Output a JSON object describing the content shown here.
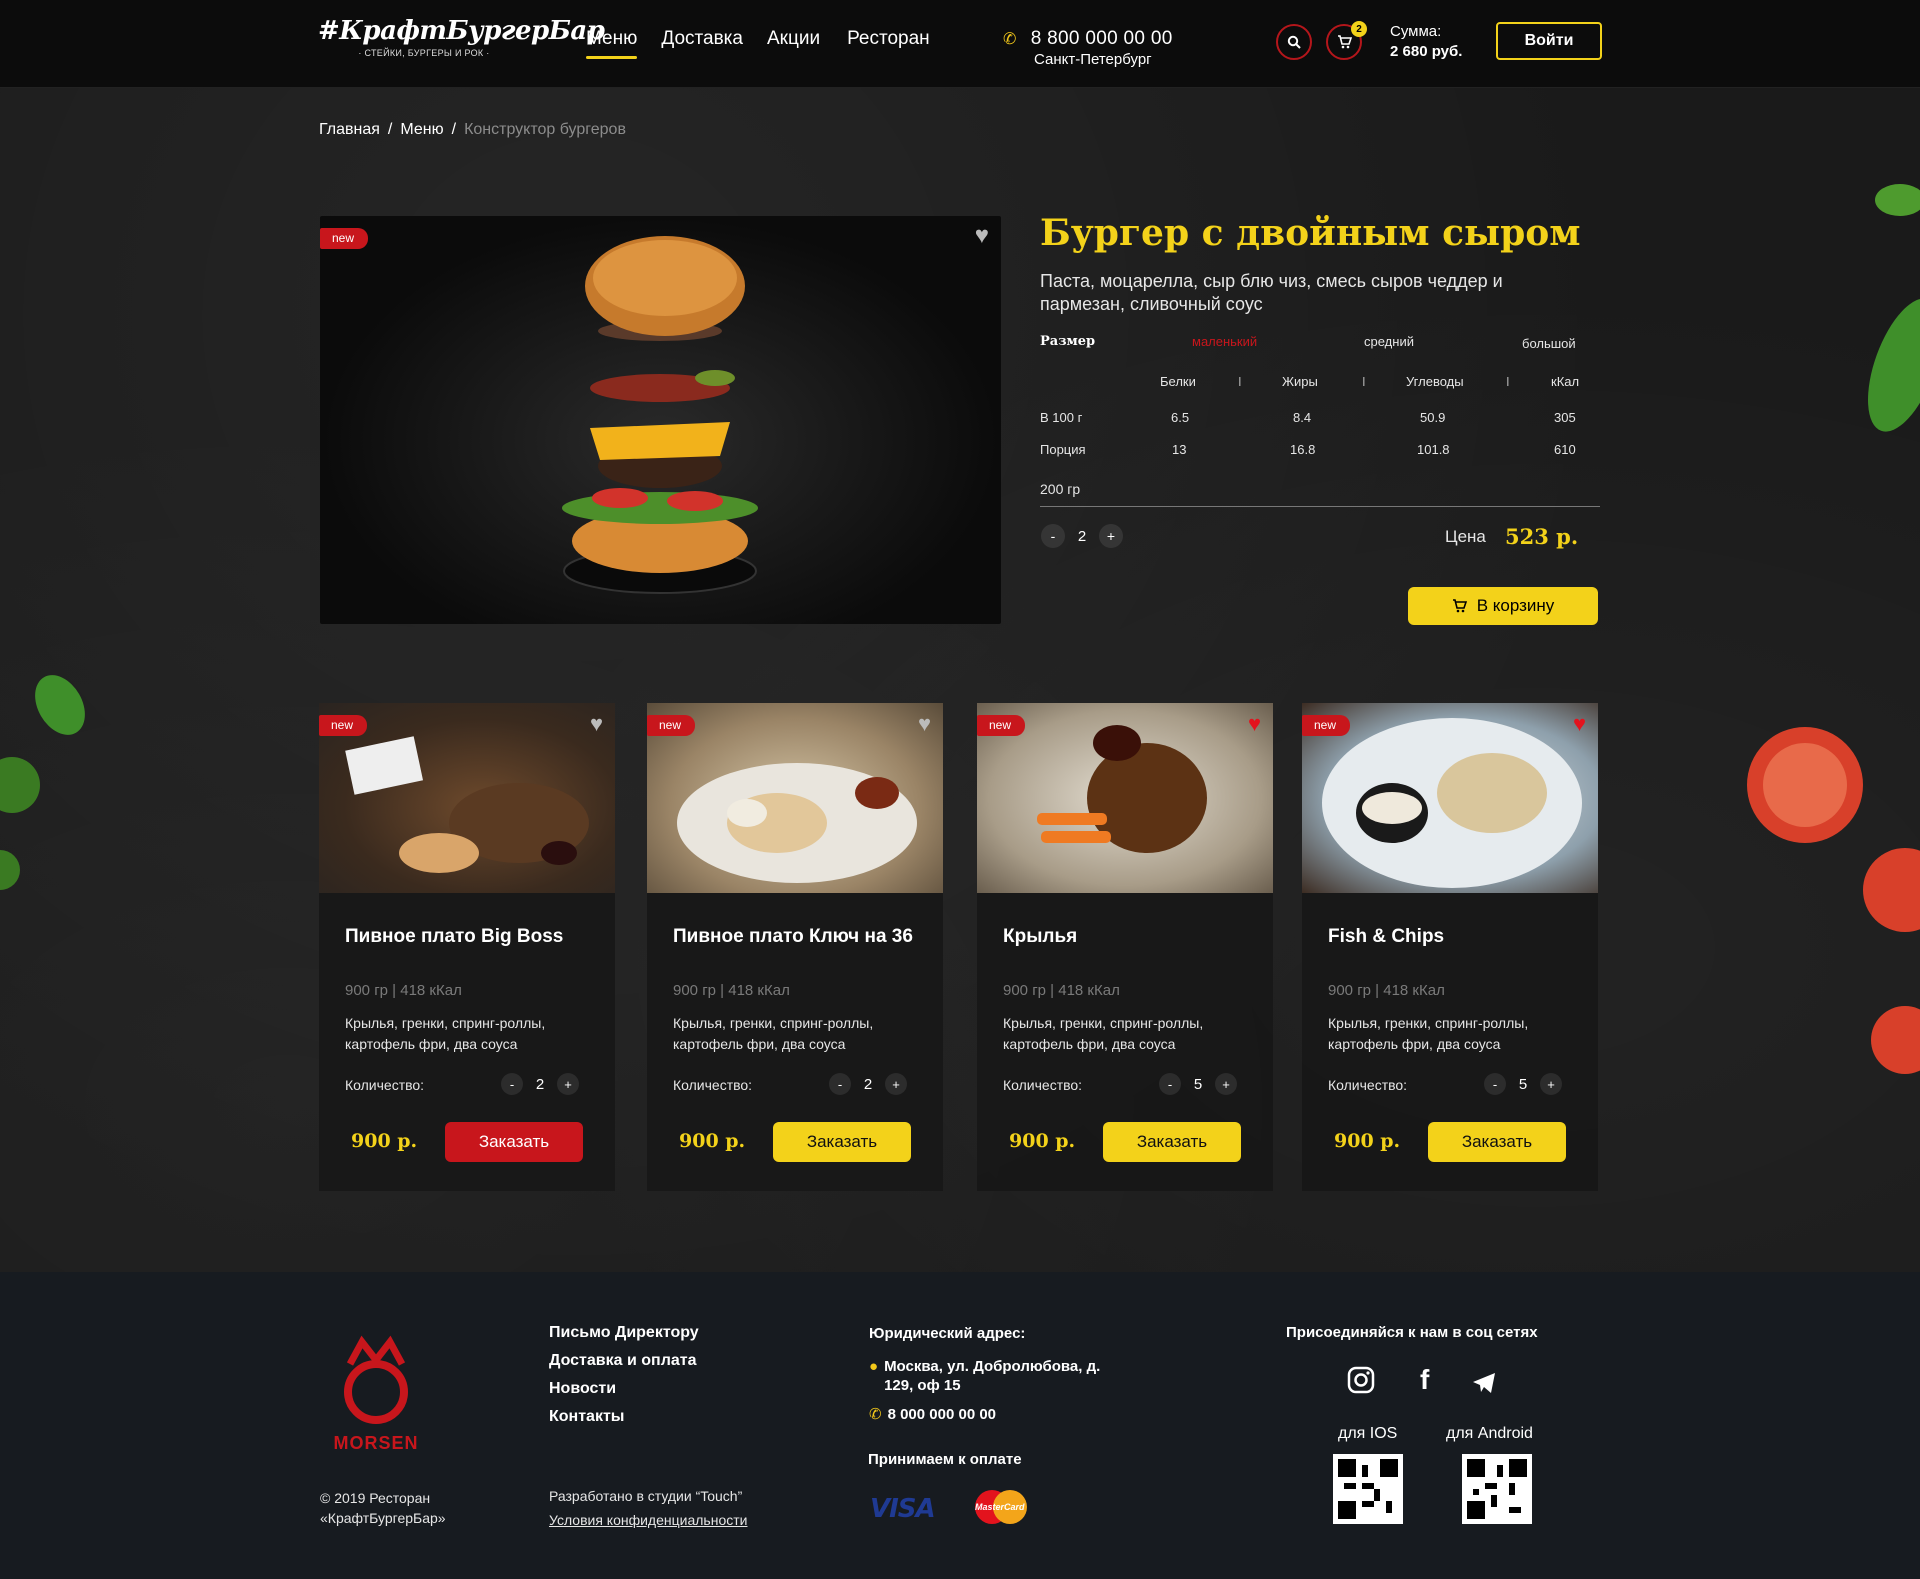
{
  "header": {
    "logo": "#КрафтБургерБар",
    "logo_sub": "· СТЕЙКИ, БУРГЕРЫ И РОК ·",
    "nav": [
      "Меню",
      "Доставка",
      "Акции",
      "Ресторан"
    ],
    "phone": "8 800 000 00 00",
    "city": "Санкт-Петербург",
    "cart_count": "2",
    "sum_label": "Сумма:",
    "sum_value": "2 680 руб.",
    "login": "Войти"
  },
  "breadcrumb": {
    "home": "Главная",
    "menu": "Меню",
    "current": "Конструктор бургеров"
  },
  "product": {
    "badge": "new",
    "title": "Бургер с двойным сыром",
    "description": "Паста, моцарелла, сыр блю чиз, смесь сыров чеддер и пармезан, сливочный соус",
    "size_label": "Размер",
    "sizes": [
      "маленький",
      "средний",
      "большой"
    ],
    "nutrition_headers": [
      "Белки",
      "Жиры",
      "Углеводы",
      "кКал"
    ],
    "rows": [
      {
        "label": "В 100 г",
        "values": [
          "6.5",
          "8.4",
          "50.9",
          "305"
        ]
      },
      {
        "label": "Порция",
        "values": [
          "13",
          "16.8",
          "101.8",
          "610"
        ]
      }
    ],
    "weight": "200 гр",
    "quantity": "2",
    "price_label": "Цена",
    "price": "523 р.",
    "add_to_cart": "В корзину"
  },
  "cards": [
    {
      "badge": "new",
      "title": "Пивное плато Big Boss",
      "meta": "900 гр | 418 кКал",
      "desc": "Крылья, гренки, спринг-роллы, картофель фри, два соуса",
      "qty_label": "Количество:",
      "qty": "2",
      "price": "900 р.",
      "order": "Заказать"
    },
    {
      "badge": "new",
      "title": "Пивное плато Ключ на 36",
      "meta": "900 гр | 418 кКал",
      "desc": "Крылья, гренки, спринг-роллы, картофель фри, два соуса",
      "qty_label": "Количество:",
      "qty": "2",
      "price": "900 р.",
      "order": "Заказать"
    },
    {
      "badge": "new",
      "title": "Крылья",
      "meta": "900 гр | 418 кКал",
      "desc": "Крылья, гренки, спринг-роллы, картофель фри, два соуса",
      "qty_label": "Количество:",
      "qty": "5",
      "price": "900 р.",
      "order": "Заказать"
    },
    {
      "badge": "new",
      "title": "Fish & Chips",
      "meta": "900 гр | 418 кКал",
      "desc": "Крылья, гренки, спринг-роллы, картофель фри, два соуса",
      "qty_label": "Количество:",
      "qty": "5",
      "price": "900 р.",
      "order": "Заказать"
    }
  ],
  "footer": {
    "morsen": "MORSEN",
    "copyright": "© 2019 Ресторан «КрафтБургерБар»",
    "links": [
      "Письмо Директору",
      "Доставка и оплата",
      "Новости",
      "Контакты"
    ],
    "studio": "Разработано в студии “Touch”",
    "privacy": "Условия конфиденциальности",
    "address_label": "Юридический адрес:",
    "address": "Москва, ул. Добролюбова, д. 129, оф 15",
    "phone": "8 000 000 00 00",
    "pay_label": "Принимаем к оплате",
    "visa": "VISA",
    "mastercard": "MasterCard",
    "social_label": "Присоединяйся к нам в соц сетях",
    "ios": "для IOS",
    "android": "для Android"
  },
  "colors": {
    "accent": "#f3d21a",
    "red": "#c8161c",
    "bg": "#1a1a1a"
  }
}
